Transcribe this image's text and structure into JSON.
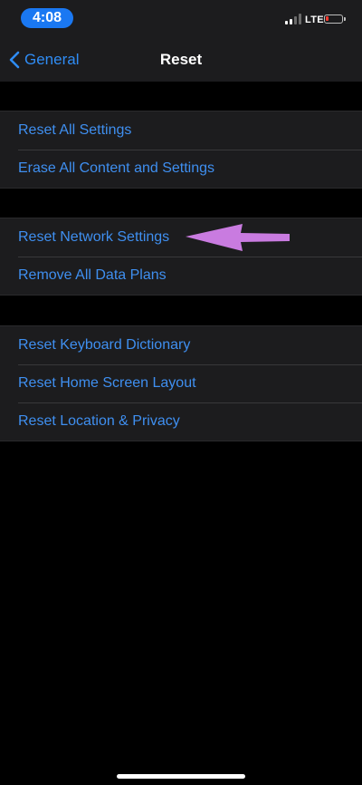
{
  "status_bar": {
    "time": "4:08",
    "network": "LTE",
    "colors": {
      "time_pill": "#1a78f2",
      "battery_low": "#ff3b30"
    }
  },
  "nav": {
    "back_label": "General",
    "title": "Reset",
    "back_icon": "chevron-left-icon"
  },
  "groups": [
    {
      "items": [
        {
          "label": "Reset All Settings"
        },
        {
          "label": "Erase All Content and Settings"
        }
      ]
    },
    {
      "items": [
        {
          "label": "Reset Network Settings"
        },
        {
          "label": "Remove All Data Plans"
        }
      ]
    },
    {
      "items": [
        {
          "label": "Reset Keyboard Dictionary"
        },
        {
          "label": "Reset Home Screen Layout"
        },
        {
          "label": "Reset Location & Privacy"
        }
      ]
    }
  ],
  "annotation": {
    "icon": "arrow-annotation-icon",
    "color": "#c97be0"
  },
  "theme": {
    "background": "#000000",
    "cell_background": "#1c1c1e",
    "link_color": "#3f8ff0"
  }
}
